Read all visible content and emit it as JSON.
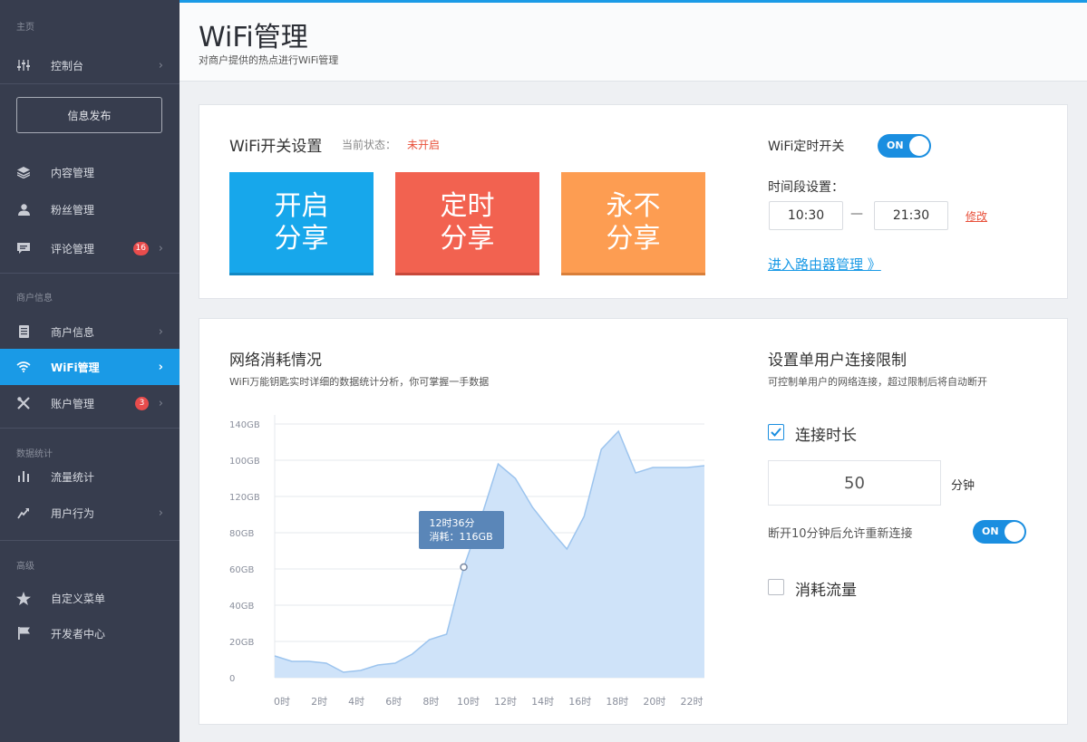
{
  "sidebar": {
    "section_main": "主页",
    "dashboard": "控制台",
    "publish_button": "信息发布",
    "content_mgmt": "内容管理",
    "fans_mgmt": "粉丝管理",
    "comment_mgmt": "评论管理",
    "comment_badge": "16",
    "section_merchant": "商户信息",
    "merchant_info": "商户信息",
    "wifi_mgmt": "WiFi管理",
    "account_mgmt": "账户管理",
    "account_badge": "3",
    "section_stats": "数据统计",
    "traffic_stats": "流量统计",
    "user_behavior": "用户行为",
    "section_advanced": "高级",
    "custom_menu": "自定义菜单",
    "dev_center": "开发者中心"
  },
  "header": {
    "title": "WiFi管理",
    "subtitle": "对商户提供的热点进行WiFi管理"
  },
  "main": {
    "switch_card": {
      "title": "WiFi开关设置",
      "status_label": "当前状态：",
      "status_value": "未开启",
      "btn_open": [
        "开启",
        "分享"
      ],
      "btn_timed": [
        "定时",
        "分享"
      ],
      "btn_never": [
        "永不",
        "分享"
      ],
      "timer_label": "WiFi定时开关",
      "timer_toggle": "ON",
      "period_label": "时间段设置：",
      "time_start": "10:30",
      "time_dash": "—",
      "time_end": "21:30",
      "edit_link": "修改",
      "router_link": "进入路由器管理 》"
    },
    "chart_card": {
      "title": "网络消耗情况",
      "subtitle": "WiFi万能钥匙实时详细的数据统计分析，你可掌握一手数据",
      "tooltip_time": "12时36分",
      "tooltip_value": "消耗：116GB",
      "chart_data": {
        "type": "area",
        "y_tick_labels": [
          "140GB",
          "100GB",
          "120GB",
          "80GB",
          "60GB",
          "40GB",
          "20GB",
          "0"
        ],
        "x_tick_labels": [
          "0时",
          "2时",
          "4时",
          "6时",
          "8时",
          "10时",
          "12时",
          "14时",
          "16时",
          "18时",
          "20时",
          "22时"
        ],
        "ylim": [
          0,
          140
        ],
        "grid": true,
        "series": [
          {
            "x": [
              0,
              1,
              2,
              3,
              4,
              5,
              6,
              7,
              8,
              9,
              10,
              11,
              12,
              13,
              14,
              15,
              16,
              17,
              18,
              19,
              20,
              21,
              22,
              23,
              24,
              25
            ],
            "values": [
              12,
              9,
              9,
              8,
              3,
              4,
              7,
              8,
              13,
              21,
              24,
              61,
              88,
              118,
              110,
              94,
              82,
              71,
              89,
              126,
              136,
              113,
              116,
              116,
              116,
              117
            ]
          }
        ],
        "highlight_point": {
          "x": 11,
          "value": 61
        },
        "fill_color": "#cfe3f9",
        "line_color": "#9cc4ee"
      }
    },
    "limit_card": {
      "title": "设置单用户连接限制",
      "subtitle": "可控制单用户的网络连接，超过限制后将自动断开",
      "duration_label": "连接时长",
      "duration_checked": true,
      "minutes_value": "50",
      "minutes_unit": "分钟",
      "reconnect_label": "断开10分钟后允许重新连接",
      "reconnect_toggle": "ON",
      "traffic_label": "消耗流量",
      "traffic_checked": false
    }
  },
  "colors": {
    "accent": "#1a9ae6",
    "sidebar_bg": "#373d4e",
    "btn_open": "#17a7eb",
    "btn_timed": "#f26250",
    "btn_never": "#fd9d52",
    "status_red": "#e8503a"
  }
}
